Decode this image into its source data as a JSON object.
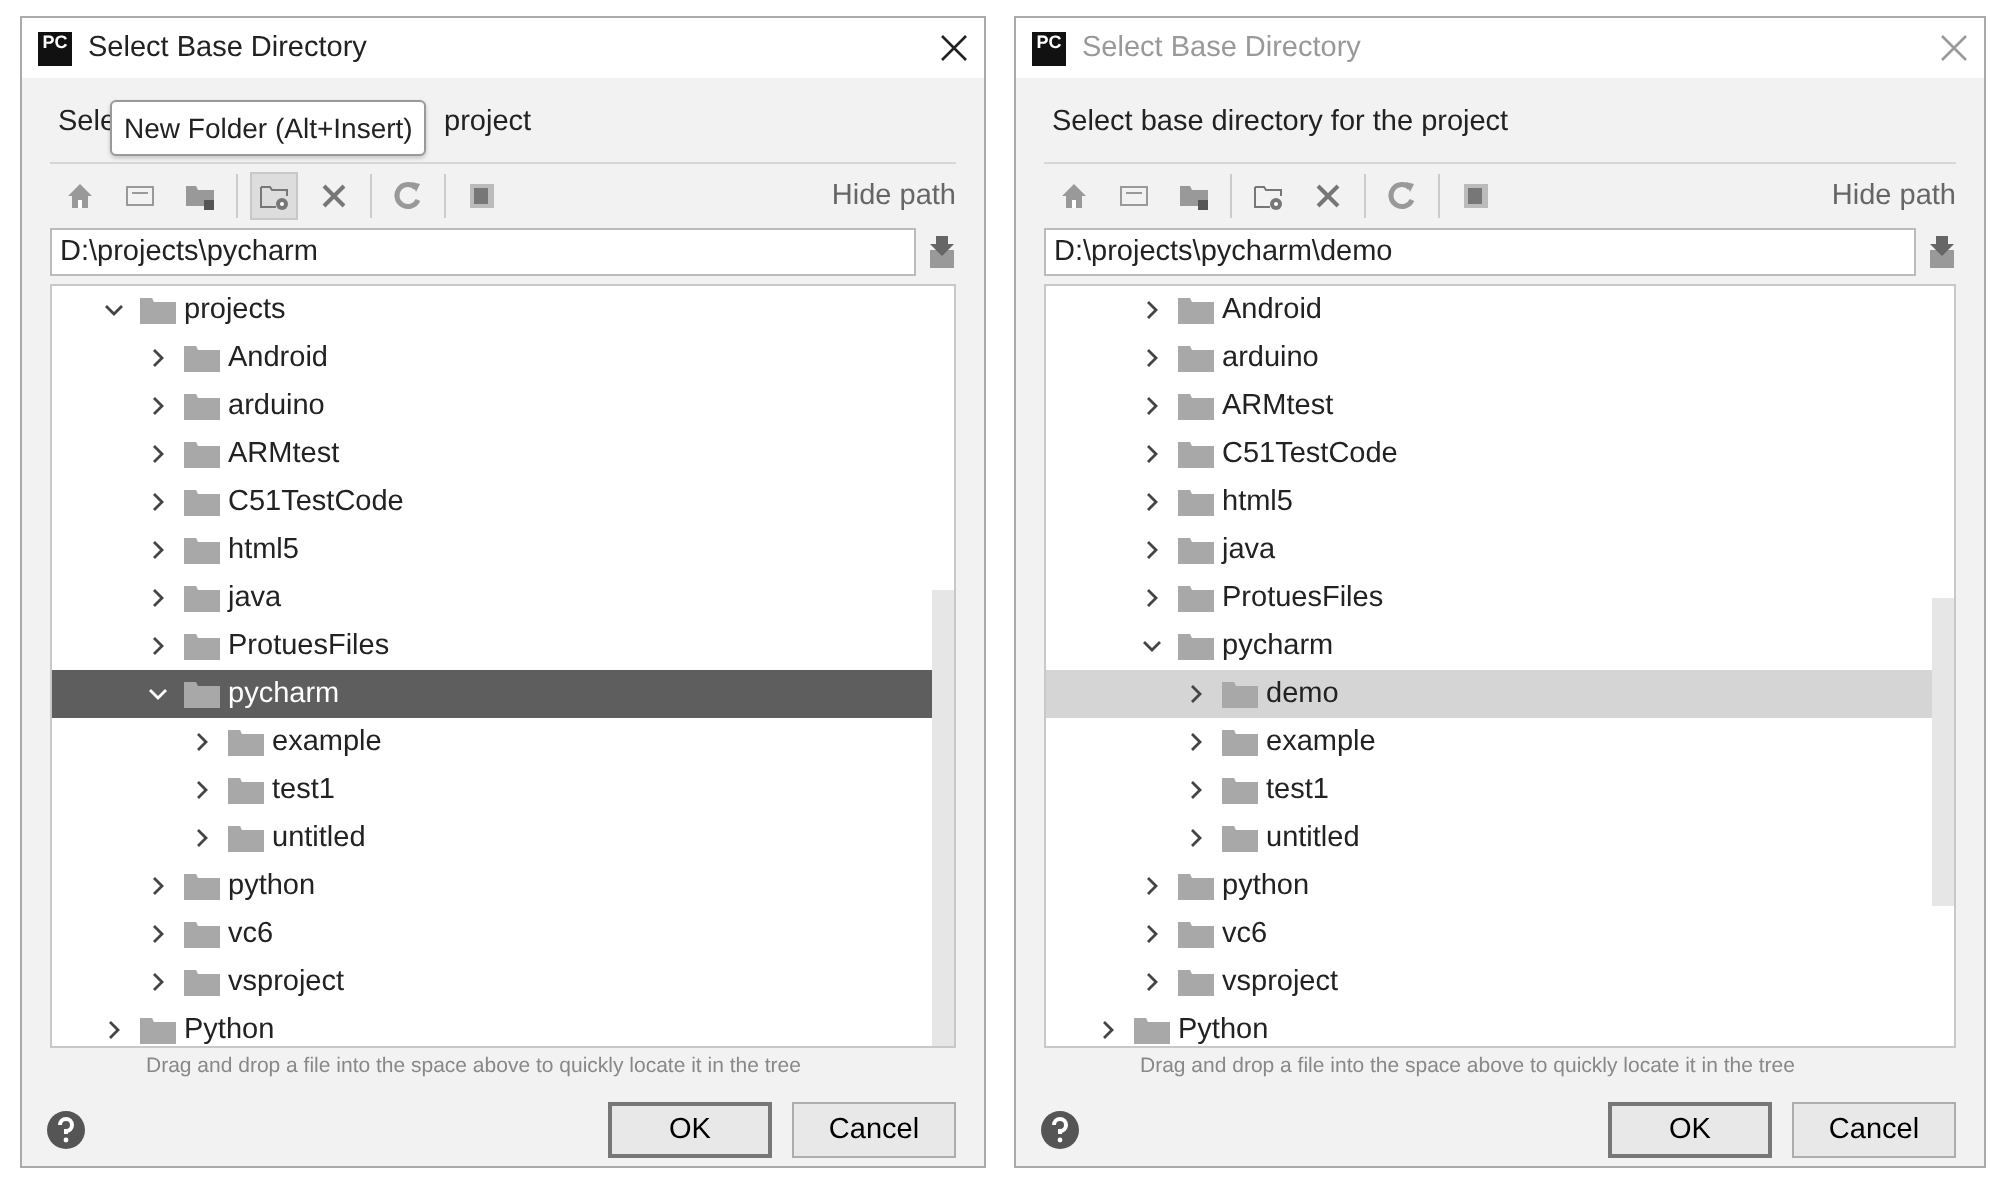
{
  "dialogs": [
    {
      "logo_text": "PC",
      "title": "Select Base Directory",
      "active": true,
      "heading_parts": [
        "Sele",
        "project"
      ],
      "tooltip": "New Folder (Alt+Insert)",
      "toolbar": [
        [
          {
            "kind": "home",
            "hovered": false
          },
          {
            "kind": "desktop",
            "hovered": false
          },
          {
            "kind": "module",
            "hovered": false
          }
        ],
        [
          {
            "kind": "new-folder",
            "hovered": true
          },
          {
            "kind": "delete",
            "hovered": false
          }
        ],
        [
          {
            "kind": "refresh",
            "hovered": false
          }
        ],
        [
          {
            "kind": "hidden",
            "hovered": false
          }
        ]
      ],
      "hide_path": "Hide path",
      "path": "D:\\projects\\pycharm",
      "tree": {
        "focused": true,
        "items": [
          {
            "name": "projects",
            "expanded": true,
            "selected": false,
            "children": [
              {
                "name": "Android",
                "expanded": false,
                "selected": false
              },
              {
                "name": "arduino",
                "expanded": false,
                "selected": false
              },
              {
                "name": "ARMtest",
                "expanded": false,
                "selected": false
              },
              {
                "name": "C51TestCode",
                "expanded": false,
                "selected": false
              },
              {
                "name": "html5",
                "expanded": false,
                "selected": false
              },
              {
                "name": "java",
                "expanded": false,
                "selected": false
              },
              {
                "name": "ProtuesFiles",
                "expanded": false,
                "selected": false
              },
              {
                "name": "pycharm",
                "expanded": true,
                "selected": true,
                "children": [
                  {
                    "name": "example",
                    "expanded": false,
                    "selected": false
                  },
                  {
                    "name": "test1",
                    "expanded": false,
                    "selected": false
                  },
                  {
                    "name": "untitled",
                    "expanded": false,
                    "selected": false
                  }
                ]
              },
              {
                "name": "python",
                "expanded": false,
                "selected": false
              },
              {
                "name": "vc6",
                "expanded": false,
                "selected": false
              },
              {
                "name": "vsproject",
                "expanded": false,
                "selected": false
              }
            ]
          },
          {
            "name": "Python",
            "expanded": false,
            "selected": false
          }
        ]
      },
      "hint": "Drag and drop a file into the space above to quickly locate it in the tree",
      "buttons": [
        {
          "label": "OK",
          "default": true
        },
        {
          "label": "Cancel",
          "default": false
        }
      ]
    },
    {
      "logo_text": "PC",
      "title": "Select Base Directory",
      "active": false,
      "heading_parts": [
        "Select base directory for the project"
      ],
      "toolbar": [
        [
          {
            "kind": "home",
            "hovered": false
          },
          {
            "kind": "desktop",
            "hovered": false
          },
          {
            "kind": "module",
            "hovered": false
          }
        ],
        [
          {
            "kind": "new-folder",
            "hovered": false
          },
          {
            "kind": "delete",
            "hovered": false
          }
        ],
        [
          {
            "kind": "refresh",
            "hovered": false
          }
        ],
        [
          {
            "kind": "hidden",
            "hovered": false
          }
        ]
      ],
      "hide_path": "Hide path",
      "path": "D:\\projects\\pycharm\\demo",
      "tree": {
        "focused": false,
        "items": [
          {
            "children": [
              {
                "name": "Android",
                "expanded": false,
                "selected": false
              },
              {
                "name": "arduino",
                "expanded": false,
                "selected": false
              },
              {
                "name": "ARMtest",
                "expanded": false,
                "selected": false
              },
              {
                "name": "C51TestCode",
                "expanded": false,
                "selected": false
              },
              {
                "name": "html5",
                "expanded": false,
                "selected": false
              },
              {
                "name": "java",
                "expanded": false,
                "selected": false
              },
              {
                "name": "ProtuesFiles",
                "expanded": false,
                "selected": false
              },
              {
                "name": "pycharm",
                "expanded": true,
                "selected": false,
                "children": [
                  {
                    "name": "demo",
                    "expanded": false,
                    "selected": true
                  },
                  {
                    "name": "example",
                    "expanded": false,
                    "selected": false
                  },
                  {
                    "name": "test1",
                    "expanded": false,
                    "selected": false
                  },
                  {
                    "name": "untitled",
                    "expanded": false,
                    "selected": false
                  }
                ]
              },
              {
                "name": "python",
                "expanded": false,
                "selected": false
              },
              {
                "name": "vc6",
                "expanded": false,
                "selected": false
              },
              {
                "name": "vsproject",
                "expanded": false,
                "selected": false
              }
            ]
          },
          {
            "name": "Python",
            "expanded": false,
            "selected": false
          }
        ]
      },
      "hint": "Drag and drop a file into the space above to quickly locate it in the tree",
      "buttons": [
        {
          "label": "OK",
          "default": true
        },
        {
          "label": "Cancel",
          "default": false
        }
      ]
    }
  ]
}
